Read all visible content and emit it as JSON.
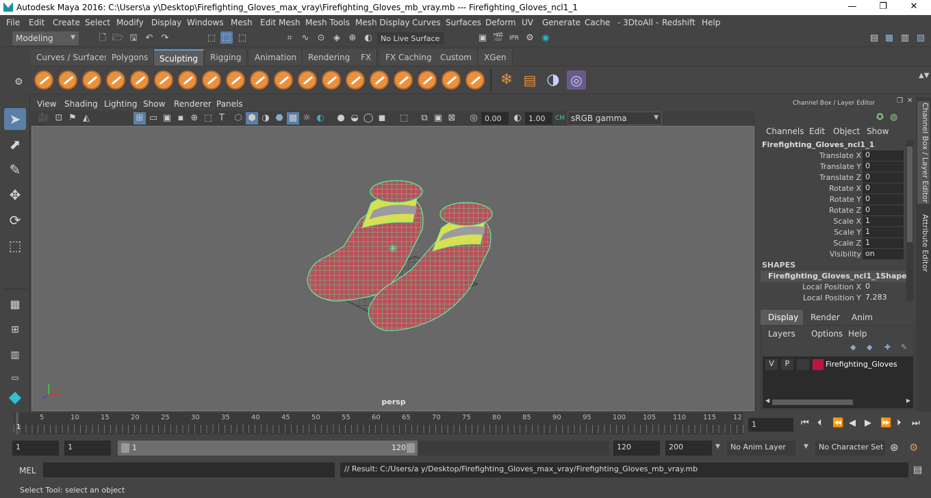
{
  "window": {
    "title": "Autodesk Maya 2016: C:\\Users\\a y\\Desktop\\Firefighting_Gloves_max_vray\\Firefighting_Gloves_mb_vray.mb   ---   Firefighting_Gloves_ncl1_1",
    "minimize": "—",
    "maximize": "❐",
    "close": "✕"
  },
  "menubar": [
    "File",
    "Edit",
    "Create",
    "Select",
    "Modify",
    "Display",
    "Windows",
    "Mesh",
    "Edit Mesh",
    "Mesh Tools",
    "Mesh Display",
    "Curves",
    "Surfaces",
    "Deform",
    "UV",
    "Generate",
    "Cache",
    "- 3DtoAll -",
    "Redshift",
    "Help"
  ],
  "statusline": {
    "menu_set": "Modeling",
    "live_surface": "No Live Surface"
  },
  "shelf_tabs": [
    "Curves / Surfaces",
    "Polygons",
    "Sculpting",
    "Rigging",
    "Animation",
    "Rendering",
    "FX",
    "FX Caching",
    "Custom",
    "XGen"
  ],
  "active_shelf_tab": "Sculpting",
  "viewport": {
    "menus": [
      "View",
      "Shading",
      "Lighting",
      "Show",
      "Renderer",
      "Panels"
    ],
    "exposure": "0.00",
    "gamma": "1.00",
    "color_space": "sRGB gamma",
    "camera": "persp"
  },
  "channel_box": {
    "title": "Channel Box / Layer Editor",
    "menus": [
      "Channels",
      "Edit",
      "Object",
      "Show"
    ],
    "object_name": "Firefighting_Gloves_ncl1_1",
    "attributes": [
      {
        "label": "Translate X",
        "value": "0"
      },
      {
        "label": "Translate Y",
        "value": "0"
      },
      {
        "label": "Translate Z",
        "value": "0"
      },
      {
        "label": "Rotate X",
        "value": "0"
      },
      {
        "label": "Rotate Y",
        "value": "0"
      },
      {
        "label": "Rotate Z",
        "value": "0"
      },
      {
        "label": "Scale X",
        "value": "1"
      },
      {
        "label": "Scale Y",
        "value": "1"
      },
      {
        "label": "Scale Z",
        "value": "1"
      },
      {
        "label": "Visibility",
        "value": "on"
      }
    ],
    "shapes_header": "SHAPES",
    "shape_name": "Firefighting_Gloves_ncl1_1Shape",
    "shape_attributes": [
      {
        "label": "Local Position X",
        "value": "0"
      },
      {
        "label": "Local Position Y",
        "value": "7.283"
      }
    ]
  },
  "side_tabs": [
    "Channel Box / Layer Editor",
    "Attribute Editor"
  ],
  "layer_editor": {
    "tabs": [
      "Display",
      "Render",
      "Anim"
    ],
    "menus": [
      "Layers",
      "Options",
      "Help"
    ],
    "layer": {
      "v": "V",
      "p": "P",
      "name": "Firefighting_Gloves",
      "color": "#c0143c"
    }
  },
  "timeline": {
    "ticks": [
      "5",
      "10",
      "15",
      "20",
      "25",
      "30",
      "35",
      "40",
      "45",
      "50",
      "55",
      "60",
      "65",
      "70",
      "75",
      "80",
      "85",
      "90",
      "95",
      "100",
      "105",
      "110",
      "115",
      "12"
    ],
    "current_frame_marker": "1",
    "current_frame": "1"
  },
  "range": {
    "start": "1",
    "playback_start": "1",
    "slider_start": "1",
    "slider_end": "120",
    "playback_end": "120",
    "end": "200",
    "anim_layer": "No Anim Layer",
    "character_set": "No Character Set"
  },
  "command": {
    "label": "MEL",
    "result": "// Result: C:/Users/a y/Desktop/Firefighting_Gloves_max_vray/Firefighting_Gloves_mb_vray.mb"
  },
  "help_line": "Select Tool: select an object",
  "colors": {
    "accent": "#5aa0d8",
    "sculpt_orange": "#e8913e",
    "wire_green": "#5cf0a0",
    "glove_red": "#b8505a",
    "stripe_yellow": "#d8e050"
  }
}
